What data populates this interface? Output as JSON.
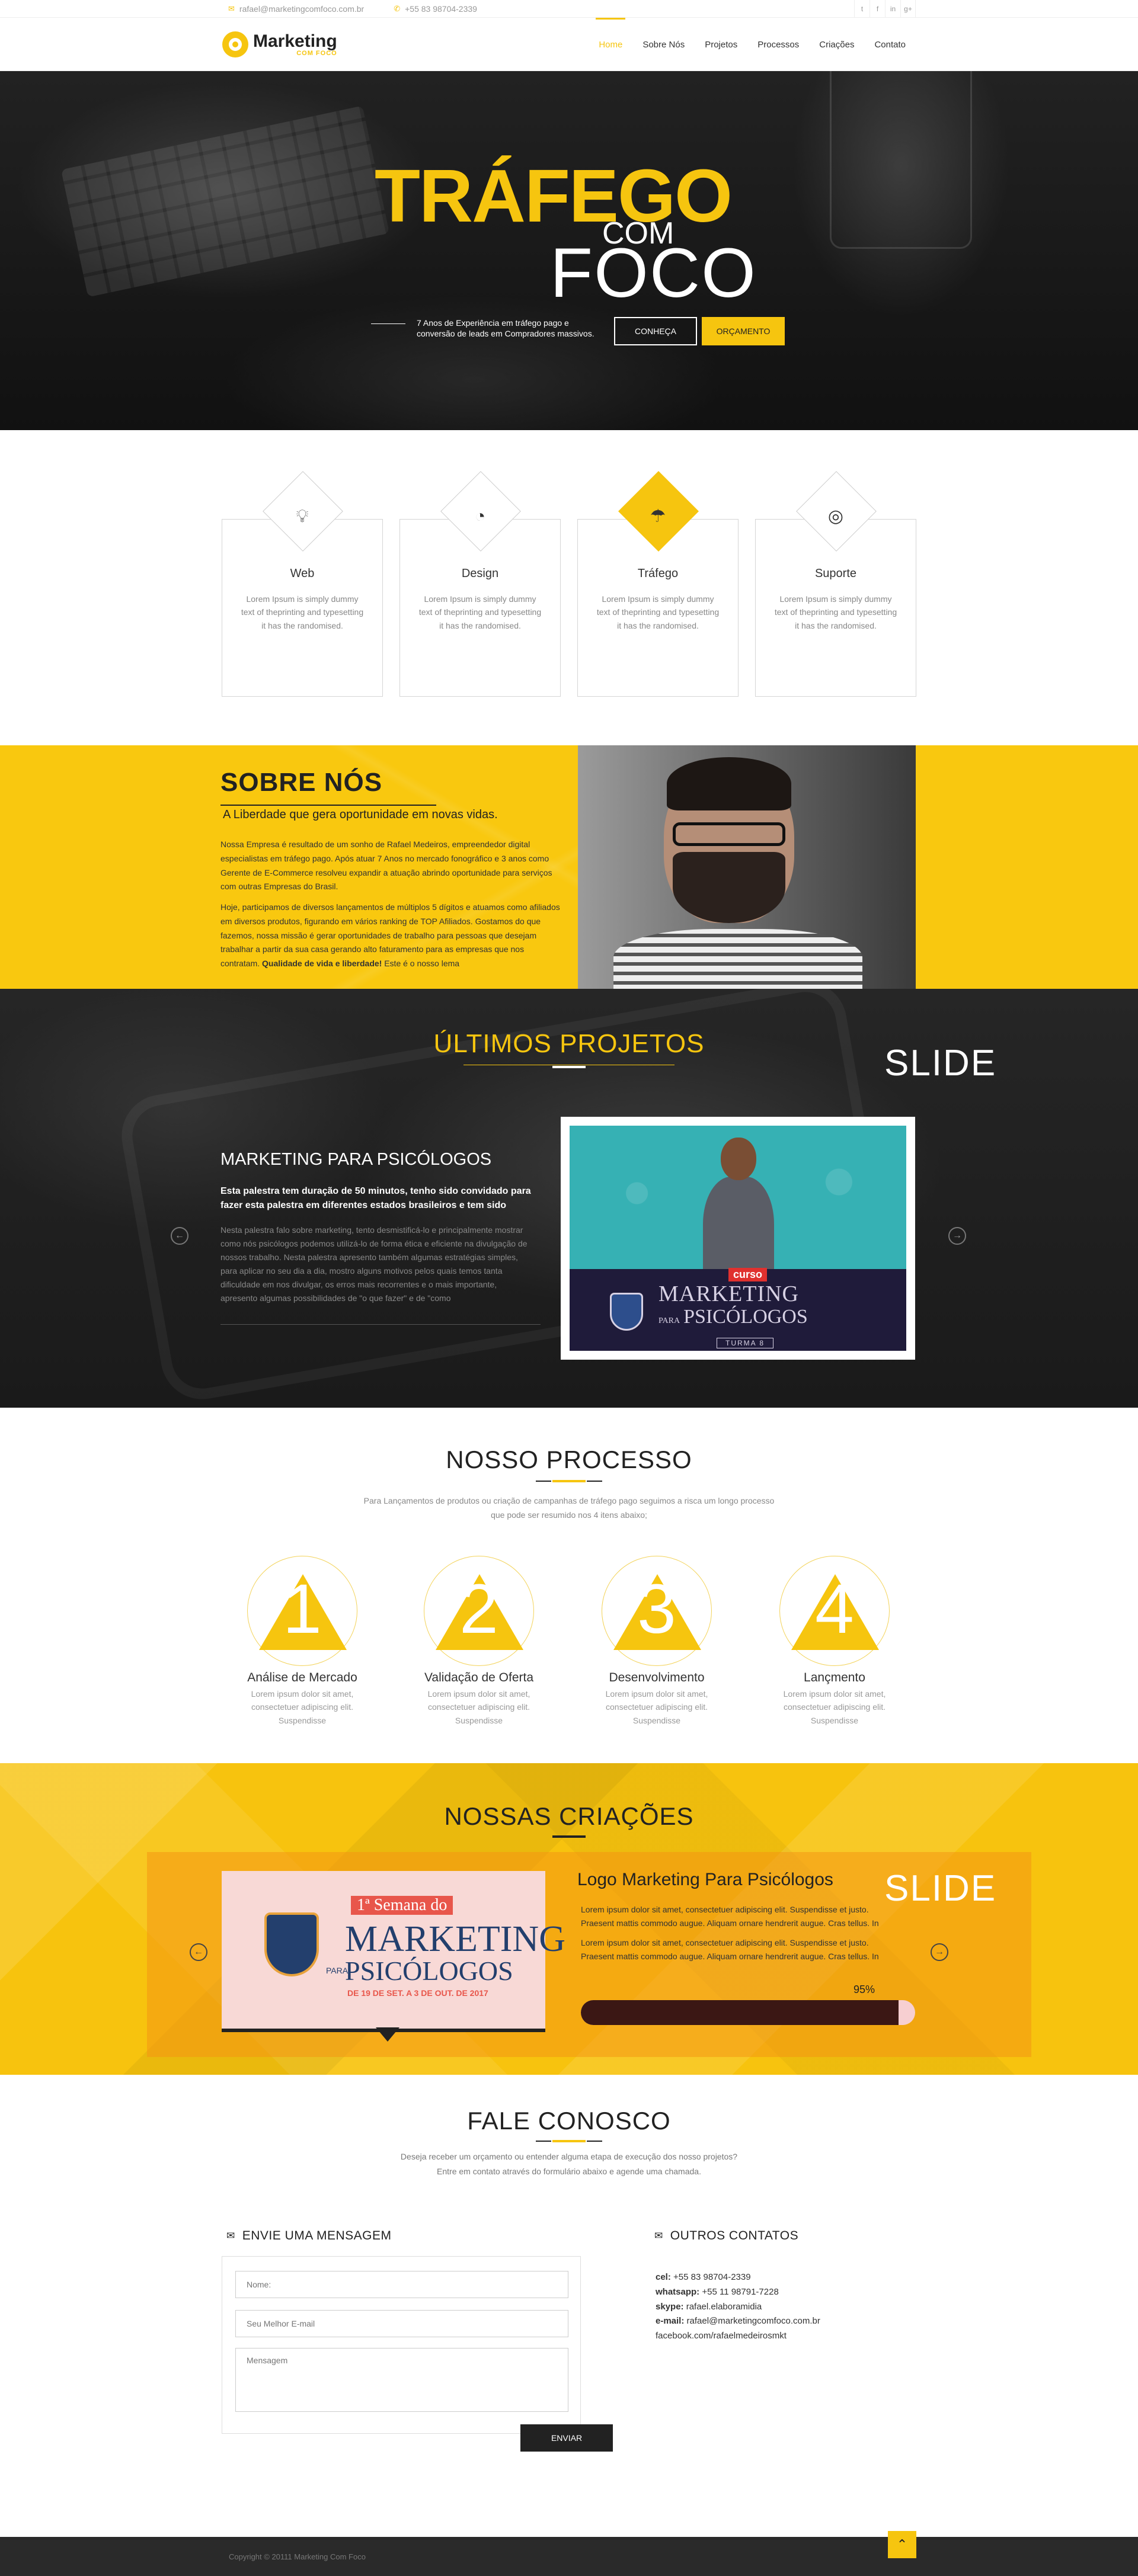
{
  "topbar": {
    "email": "rafael@marketingcomfoco.com.br",
    "phone": "+55 83 98704-2339",
    "social": [
      "twitter-icon",
      "facebook-icon",
      "linkedin-icon",
      "google-plus-icon"
    ],
    "social_glyphs": [
      "t",
      "f",
      "in",
      "g+"
    ]
  },
  "header": {
    "logo_main": "Marketing",
    "logo_sub": "COM FOCO",
    "nav": [
      "Home",
      "Sobre Nós",
      "Projetos",
      "Processos",
      "Criações",
      "Contato"
    ],
    "active_nav": "Home"
  },
  "hero": {
    "title_line1": "TRÁFEGO",
    "title_line2": "COM",
    "title_line3": "FOCO",
    "subtitle": "7 Anos de Experiência em tráfego pago e conversão de leads em Compradores massivos.",
    "btn_conheca": "CONHEÇA",
    "btn_orcamento": "ORÇAMENTO"
  },
  "services": [
    {
      "icon": "lightbulb-icon",
      "glyph": "♡",
      "title": "Web",
      "text": "Lorem Ipsum is simply dummy text of theprinting and typesetting it has the randomised.",
      "active": false
    },
    {
      "icon": "pie-chart-icon",
      "glyph": "◔",
      "title": "Design",
      "text": "Lorem Ipsum is simply dummy text of theprinting and typesetting it has the randomised.",
      "active": false
    },
    {
      "icon": "umbrella-icon",
      "glyph": "☂",
      "title": "Tráfego",
      "text": "Lorem Ipsum is simply dummy text of theprinting and typesetting it has the randomised.",
      "active": true
    },
    {
      "icon": "support-lifebuoy-icon",
      "glyph": "◎",
      "title": "Suporte",
      "text": "Lorem Ipsum is simply dummy text of theprinting and typesetting it has the randomised.",
      "active": false
    }
  ],
  "sobre": {
    "title": "SOBRE NÓS",
    "subtitle": "A Liberdade que gera oportunidade em novas vidas.",
    "p1": "Nossa Empresa é resultado de um sonho de Rafael Medeiros, empreendedor digital especialistas em tráfego pago. Após atuar 7 Anos no mercado fonográfico e 3 anos como Gerente de E-Commerce resolveu expandir a atuação abrindo oportunidade para serviços com outras Empresas do Brasil.",
    "p2_start": "Hoje, participamos de diversos lançamentos de múltiplos 5 dígitos e atuamos como afiliados em diversos produtos, figurando em vários ranking de TOP Afiliados. Gostamos do que fazemos, nossa missão é gerar oportunidades de trabalho para pessoas que desejam trabalhar a partir da sua casa gerando alto faturamento para as empresas que nos contratam. ",
    "p2_bold": "Qualidade de vida e liberdade!",
    "p2_end": " Este é o nosso lema"
  },
  "projetos": {
    "title": "ÚLTIMOS PROJETOS",
    "slide_tag": "SLIDE",
    "item_title": "MARKETING PARA PSICÓLOGOS",
    "item_lead": "Esta palestra tem duração de 50 minutos, tenho sido convidado para fazer esta palestra em diferentes estados brasileiros e tem sido",
    "item_body": "Nesta palestra falo sobre marketing, tento desmistificá-lo e principalmente mostrar como nós psicólogos podemos utilizá-lo de forma ética e eficiente na divulgação de nossos trabalho. Nesta palestra apresento também algumas estratégias simples, para aplicar no seu dia a dia, mostro alguns motivos pelos quais temos tanta dificuldade em nos divulgar, os erros mais recorrentes e o mais importante, apresento algumas possibilidades de \"o que fazer\" e de \"como",
    "image": {
      "badge": "curso",
      "line1": "MARKETING",
      "para": "PARA",
      "line2": "PSICÓLOGOS",
      "turma": "TURMA 8"
    }
  },
  "processo": {
    "title": "NOSSO PROCESSO",
    "desc": "Para Lançamentos de produtos ou criação de campanhas de tráfego pago seguimos a risca um longo processo que pode ser resumido nos 4 itens abaixo;",
    "steps": [
      {
        "num": "1",
        "title": "Análise de Mercado",
        "text": "Lorem ipsum dolor sit amet, consectetuer adipiscing elit. Suspendisse"
      },
      {
        "num": "2",
        "title": "Validação de Oferta",
        "text": "Lorem ipsum dolor sit amet, consectetuer adipiscing elit. Suspendisse"
      },
      {
        "num": "3",
        "title": "Desenvolvimento",
        "text": "Lorem ipsum dolor sit amet, consectetuer adipiscing elit. Suspendisse"
      },
      {
        "num": "4",
        "title": "Lançmento",
        "text": "Lorem ipsum dolor sit amet, consectetuer adipiscing elit. Suspendisse"
      }
    ]
  },
  "criacoes": {
    "title": "NOSSAS CRIAÇÕES",
    "slide_tag": "SLIDE",
    "item_title": "Logo Marketing Para Psicólogos",
    "p1": "Lorem ipsum dolor sit amet, consectetuer adipiscing elit. Suspendisse et justo. Praesent mattis commodo augue. Aliquam ornare hendrerit augue. Cras tellus. In",
    "p2": "Lorem ipsum dolor sit amet, consectetuer adipiscing elit. Suspendisse et justo. Praesent mattis commodo augue. Aliquam ornare hendrerit augue. Cras tellus. In",
    "progress_label": "95%",
    "progress": 0.95,
    "image": {
      "semana": "1ª Semana do",
      "line1": "MARKETING",
      "para": "PARA",
      "line2": "PSICÓLOGOS",
      "date": "DE 19 DE SET. A 3 DE OUT. DE 2017"
    }
  },
  "contato": {
    "title": "FALE CONOSCO",
    "desc_l1": "Deseja receber um orçamento ou entender alguma etapa de execução dos nosso projetos?",
    "desc_l2": "Entre em contato através do formulário abaixo e agende uma chamada.",
    "form_title": "ENVIE UMA MENSAGEM",
    "ph_name": "Nome:",
    "ph_email": "Seu Melhor E-mail",
    "ph_msg": "Mensagem",
    "send": "ENVIAR",
    "info_title": "OUTROS CONTATOS",
    "cel_label": "cel:",
    "cel": " +55 83 98704-2339",
    "wa_label": "whatsapp:",
    "wa": " +55 11 98791-7228",
    "skype_label": "skype:",
    "skype": " rafael.elaboramidia",
    "email_label": "e-mail:",
    "email": "  rafael@marketingcomfoco.com.br",
    "facebook": "facebook.com/rafaelmedeirosmkt"
  },
  "footer": {
    "copy": "Copyright © 20111 Marketing Com Foco",
    "top_glyph": "⌃"
  },
  "colors": {
    "accent": "#f6c50f",
    "dark": "#222222"
  }
}
